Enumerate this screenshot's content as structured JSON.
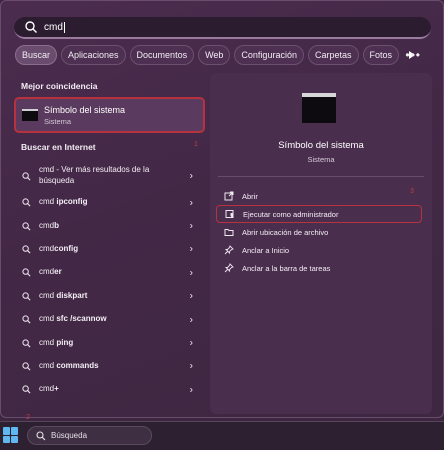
{
  "search": {
    "query": "cmd"
  },
  "tabs": [
    "Buscar",
    "Aplicaciones",
    "Documentos",
    "Web",
    "Configuración",
    "Carpetas",
    "Fotos"
  ],
  "more_label": "•••",
  "best_match": {
    "heading": "Mejor coincidencia",
    "title": "Símbolo del sistema",
    "subtitle": "Sistema",
    "marker": "1"
  },
  "internet": {
    "heading": "Buscar en Internet",
    "items": [
      {
        "pre": "cmd",
        "bold": "",
        "post": " - Ver más resultados de la búsqueda"
      },
      {
        "pre": "cmd ",
        "bold": "ipconfig",
        "post": ""
      },
      {
        "pre": "cmd",
        "bold": "b",
        "post": ""
      },
      {
        "pre": "cmd",
        "bold": "config",
        "post": ""
      },
      {
        "pre": "cmd",
        "bold": "er",
        "post": ""
      },
      {
        "pre": "cmd ",
        "bold": "diskpart",
        "post": ""
      },
      {
        "pre": "cmd ",
        "bold": "sfc /scannow",
        "post": ""
      },
      {
        "pre": "cmd ",
        "bold": "ping",
        "post": ""
      },
      {
        "pre": "cmd ",
        "bold": "commands",
        "post": ""
      },
      {
        "pre": "cmd",
        "bold": "+",
        "post": ""
      }
    ]
  },
  "detail": {
    "title": "Símbolo del sistema",
    "subtitle": "Sistema",
    "marker": "3",
    "actions": [
      {
        "label": "Abrir",
        "icon": "open-external-icon"
      },
      {
        "label": "Ejecutar como administrador",
        "icon": "shield-admin-icon"
      },
      {
        "label": "Abrir ubicación de archivo",
        "icon": "folder-icon"
      },
      {
        "label": "Anclar a Inicio",
        "icon": "pin-icon"
      },
      {
        "label": "Anclar a la barra de tareas",
        "icon": "pin-icon"
      }
    ]
  },
  "taskbar": {
    "search_placeholder": "Búsqueda",
    "marker": "2"
  },
  "colors": {
    "accent_highlight": "#b5323e",
    "panel": "#4b2c4f",
    "start_icon": "#5fb8f0"
  }
}
